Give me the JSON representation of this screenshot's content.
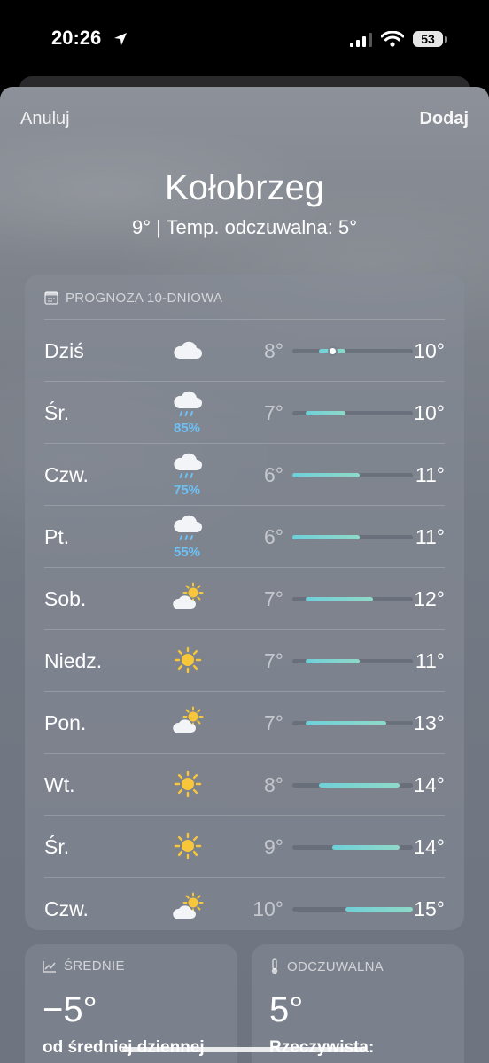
{
  "status_bar": {
    "time": "20:26",
    "battery": "53"
  },
  "sheet": {
    "cancel_label": "Anuluj",
    "add_label": "Dodaj",
    "city": "Kołobrzeg",
    "summary": "9°  |  Temp. odczuwalna: 5°"
  },
  "forecast": {
    "title": "PROGNOZA 10-DNIOWA",
    "range_min": 6,
    "range_max": 15,
    "current_temp": 9,
    "days": [
      {
        "day": "Dziś",
        "icon": "cloud-icon",
        "precip": "",
        "low": "8°",
        "high": "10°",
        "low_val": 8,
        "high_val": 10,
        "now": true
      },
      {
        "day": "Śr.",
        "icon": "cloud-rain-icon",
        "precip": "85%",
        "low": "7°",
        "high": "10°",
        "low_val": 7,
        "high_val": 10
      },
      {
        "day": "Czw.",
        "icon": "cloud-rain-icon",
        "precip": "75%",
        "low": "6°",
        "high": "11°",
        "low_val": 6,
        "high_val": 11
      },
      {
        "day": "Pt.",
        "icon": "cloud-rain-icon",
        "precip": "55%",
        "low": "6°",
        "high": "11°",
        "low_val": 6,
        "high_val": 11
      },
      {
        "day": "Sob.",
        "icon": "partly-sunny-icon",
        "precip": "",
        "low": "7°",
        "high": "12°",
        "low_val": 7,
        "high_val": 12
      },
      {
        "day": "Niedz.",
        "icon": "sun-icon",
        "precip": "",
        "low": "7°",
        "high": "11°",
        "low_val": 7,
        "high_val": 11
      },
      {
        "day": "Pon.",
        "icon": "partly-sunny-icon",
        "precip": "",
        "low": "7°",
        "high": "13°",
        "low_val": 7,
        "high_val": 13
      },
      {
        "day": "Wt.",
        "icon": "sun-icon",
        "precip": "",
        "low": "8°",
        "high": "14°",
        "low_val": 8,
        "high_val": 14
      },
      {
        "day": "Śr.",
        "icon": "sun-icon",
        "precip": "",
        "low": "9°",
        "high": "14°",
        "low_val": 9,
        "high_val": 14
      },
      {
        "day": "Czw.",
        "icon": "partly-sunny-icon",
        "precip": "",
        "low": "10°",
        "high": "15°",
        "low_val": 10,
        "high_val": 15
      }
    ]
  },
  "averages": {
    "title": "ŚREDNIE",
    "value": "−5°",
    "subtitle": "od średniej dziennej"
  },
  "feels_like": {
    "title": "ODCZUWALNA",
    "value": "5°",
    "subtitle": "Rzeczywista:"
  }
}
